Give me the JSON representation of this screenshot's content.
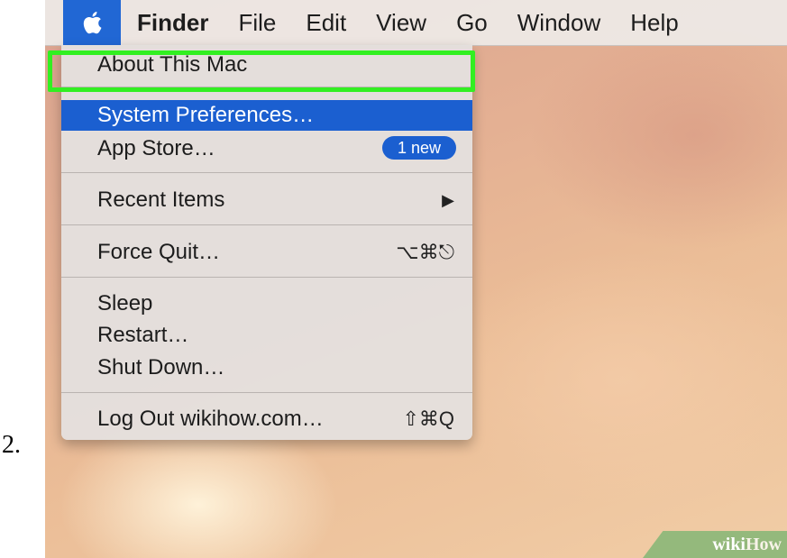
{
  "step_number": "2.",
  "menubar": {
    "apple_icon": "apple-logo-icon",
    "items": [
      "Finder",
      "File",
      "Edit",
      "View",
      "Go",
      "Window",
      "Help"
    ]
  },
  "apple_menu": {
    "about": "About This Mac",
    "system_preferences": "System Preferences…",
    "app_store": "App Store…",
    "app_store_badge": "1 new",
    "recent_items": "Recent Items",
    "recent_items_arrow": "▶",
    "force_quit": "Force Quit…",
    "force_quit_shortcut": "⌥⌘⎋",
    "sleep": "Sleep",
    "restart": "Restart…",
    "shut_down": "Shut Down…",
    "log_out": "Log Out wikihow.com…",
    "log_out_shortcut": "⇧⌘Q"
  },
  "highlight_color": "#32ef21",
  "selection_color": "#1b5fd0",
  "watermark": {
    "wiki": "wiki",
    "how": "How"
  }
}
